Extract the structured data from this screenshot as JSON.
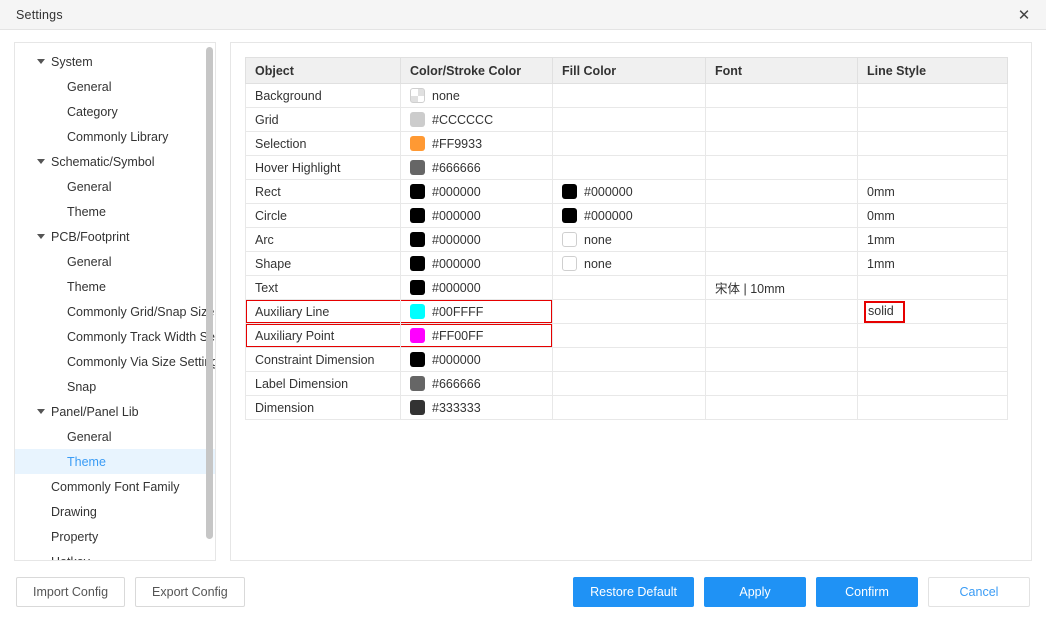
{
  "window": {
    "title": "Settings",
    "close_icon": "close-icon"
  },
  "sidebar": {
    "items": [
      {
        "label": "System",
        "level": 0,
        "expandable": true,
        "selected": false
      },
      {
        "label": "General",
        "level": 1,
        "expandable": false,
        "selected": false
      },
      {
        "label": "Category",
        "level": 1,
        "expandable": false,
        "selected": false
      },
      {
        "label": "Commonly Library",
        "level": 1,
        "expandable": false,
        "selected": false
      },
      {
        "label": "Schematic/Symbol",
        "level": 0,
        "expandable": true,
        "selected": false
      },
      {
        "label": "General",
        "level": 1,
        "expandable": false,
        "selected": false
      },
      {
        "label": "Theme",
        "level": 1,
        "expandable": false,
        "selected": false
      },
      {
        "label": "PCB/Footprint",
        "level": 0,
        "expandable": true,
        "selected": false
      },
      {
        "label": "General",
        "level": 1,
        "expandable": false,
        "selected": false
      },
      {
        "label": "Theme",
        "level": 1,
        "expandable": false,
        "selected": false
      },
      {
        "label": "Commonly Grid/Snap Size S",
        "level": 1,
        "expandable": false,
        "selected": false
      },
      {
        "label": "Commonly Track Width Setti",
        "level": 1,
        "expandable": false,
        "selected": false
      },
      {
        "label": "Commonly Via Size Setting",
        "level": 1,
        "expandable": false,
        "selected": false
      },
      {
        "label": "Snap",
        "level": 1,
        "expandable": false,
        "selected": false
      },
      {
        "label": "Panel/Panel Lib",
        "level": 0,
        "expandable": true,
        "selected": false
      },
      {
        "label": "General",
        "level": 1,
        "expandable": false,
        "selected": false
      },
      {
        "label": "Theme",
        "level": 1,
        "expandable": false,
        "selected": true
      },
      {
        "label": "Commonly Font Family",
        "level": 2,
        "expandable": false,
        "selected": false
      },
      {
        "label": "Drawing",
        "level": 2,
        "expandable": false,
        "selected": false
      },
      {
        "label": "Property",
        "level": 2,
        "expandable": false,
        "selected": false
      },
      {
        "label": "Hotkey",
        "level": 2,
        "expandable": false,
        "selected": false
      }
    ]
  },
  "table": {
    "columns": [
      "Object",
      "Color/Stroke Color",
      "Fill Color",
      "Font",
      "Line Style"
    ],
    "rows": [
      {
        "object": "Background",
        "stroke": {
          "text": "none",
          "swatch": "checker",
          "color": ""
        },
        "fill": {
          "text": "",
          "swatch": "none",
          "color": "",
          "disabled": true
        },
        "font": {
          "text": "",
          "disabled": true
        },
        "line": {
          "text": "",
          "disabled": true
        },
        "highlight": false
      },
      {
        "object": "Grid",
        "stroke": {
          "text": "#CCCCCC",
          "swatch": "solid",
          "color": "#CCCCCC"
        },
        "fill": {
          "text": "",
          "swatch": "none",
          "color": "",
          "disabled": true
        },
        "font": {
          "text": "",
          "disabled": true
        },
        "line": {
          "text": "",
          "disabled": true
        },
        "highlight": false
      },
      {
        "object": "Selection",
        "stroke": {
          "text": "#FF9933",
          "swatch": "solid",
          "color": "#FF9933"
        },
        "fill": {
          "text": "",
          "swatch": "none",
          "color": "",
          "disabled": true
        },
        "font": {
          "text": "",
          "disabled": true
        },
        "line": {
          "text": "",
          "disabled": true
        },
        "highlight": false
      },
      {
        "object": "Hover Highlight",
        "stroke": {
          "text": "#666666",
          "swatch": "solid",
          "color": "#666666"
        },
        "fill": {
          "text": "",
          "swatch": "none",
          "color": "",
          "disabled": true
        },
        "font": {
          "text": "",
          "disabled": true
        },
        "line": {
          "text": "",
          "disabled": true
        },
        "highlight": false
      },
      {
        "object": "Rect",
        "stroke": {
          "text": "#000000",
          "swatch": "solid",
          "color": "#000000"
        },
        "fill": {
          "text": "#000000",
          "swatch": "solid",
          "color": "#000000"
        },
        "font": {
          "text": "",
          "disabled": true
        },
        "line": {
          "text": "0mm",
          "disabled": false
        },
        "highlight": false
      },
      {
        "object": "Circle",
        "stroke": {
          "text": "#000000",
          "swatch": "solid",
          "color": "#000000"
        },
        "fill": {
          "text": "#000000",
          "swatch": "solid",
          "color": "#000000"
        },
        "font": {
          "text": "",
          "disabled": true
        },
        "line": {
          "text": "0mm",
          "disabled": false
        },
        "highlight": false
      },
      {
        "object": "Arc",
        "stroke": {
          "text": "#000000",
          "swatch": "solid",
          "color": "#000000"
        },
        "fill": {
          "text": "none",
          "swatch": "empty",
          "color": ""
        },
        "font": {
          "text": "",
          "disabled": true
        },
        "line": {
          "text": "1mm",
          "disabled": false
        },
        "highlight": false
      },
      {
        "object": "Shape",
        "stroke": {
          "text": "#000000",
          "swatch": "solid",
          "color": "#000000"
        },
        "fill": {
          "text": "none",
          "swatch": "empty",
          "color": ""
        },
        "font": {
          "text": "",
          "disabled": true
        },
        "line": {
          "text": "1mm",
          "disabled": false
        },
        "highlight": false
      },
      {
        "object": "Text",
        "stroke": {
          "text": "#000000",
          "swatch": "solid",
          "color": "#000000"
        },
        "fill": {
          "text": "",
          "swatch": "none",
          "color": "",
          "disabled": true
        },
        "font": {
          "text": "宋体 | 10mm",
          "disabled": false
        },
        "line": {
          "text": "",
          "disabled": true
        },
        "highlight": false
      },
      {
        "object": "Auxiliary  Line",
        "stroke": {
          "text": "#00FFFF",
          "swatch": "solid",
          "color": "#00FFFF"
        },
        "fill": {
          "text": "",
          "swatch": "none",
          "color": "",
          "disabled": true
        },
        "font": {
          "text": "",
          "disabled": true
        },
        "line": {
          "text": "solid",
          "disabled": false,
          "boxed": true
        },
        "highlight": true
      },
      {
        "object": "Auxiliary  Point",
        "stroke": {
          "text": "#FF00FF",
          "swatch": "solid",
          "color": "#FF00FF"
        },
        "fill": {
          "text": "",
          "swatch": "none",
          "color": "",
          "disabled": true
        },
        "font": {
          "text": "",
          "disabled": true
        },
        "line": {
          "text": "",
          "disabled": true
        },
        "highlight": true
      },
      {
        "object": "Constraint  Dimension",
        "stroke": {
          "text": "#000000",
          "swatch": "solid",
          "color": "#000000"
        },
        "fill": {
          "text": "",
          "swatch": "none",
          "color": "",
          "disabled": true
        },
        "font": {
          "text": "",
          "disabled": true
        },
        "line": {
          "text": "",
          "disabled": true
        },
        "highlight": false
      },
      {
        "object": "Label  Dimension",
        "stroke": {
          "text": "#666666",
          "swatch": "solid",
          "color": "#666666"
        },
        "fill": {
          "text": "",
          "swatch": "none",
          "color": "",
          "disabled": true
        },
        "font": {
          "text": "",
          "disabled": true
        },
        "line": {
          "text": "",
          "disabled": true
        },
        "highlight": false
      },
      {
        "object": "Dimension",
        "stroke": {
          "text": "#333333",
          "swatch": "solid",
          "color": "#333333"
        },
        "fill": {
          "text": "",
          "swatch": "none",
          "color": "",
          "disabled": true
        },
        "font": {
          "text": "",
          "disabled": true
        },
        "line": {
          "text": "",
          "disabled": true
        },
        "highlight": false
      }
    ]
  },
  "footer": {
    "import_config": "Import Config",
    "export_config": "Export Config",
    "restore_default": "Restore Default",
    "apply": "Apply",
    "confirm": "Confirm",
    "cancel": "Cancel"
  },
  "colors": {
    "accent_blue": "#1F92F5",
    "selected_bg": "#E8F4FE",
    "selected_text": "#3B9CF5",
    "highlight_red": "#E60000"
  }
}
